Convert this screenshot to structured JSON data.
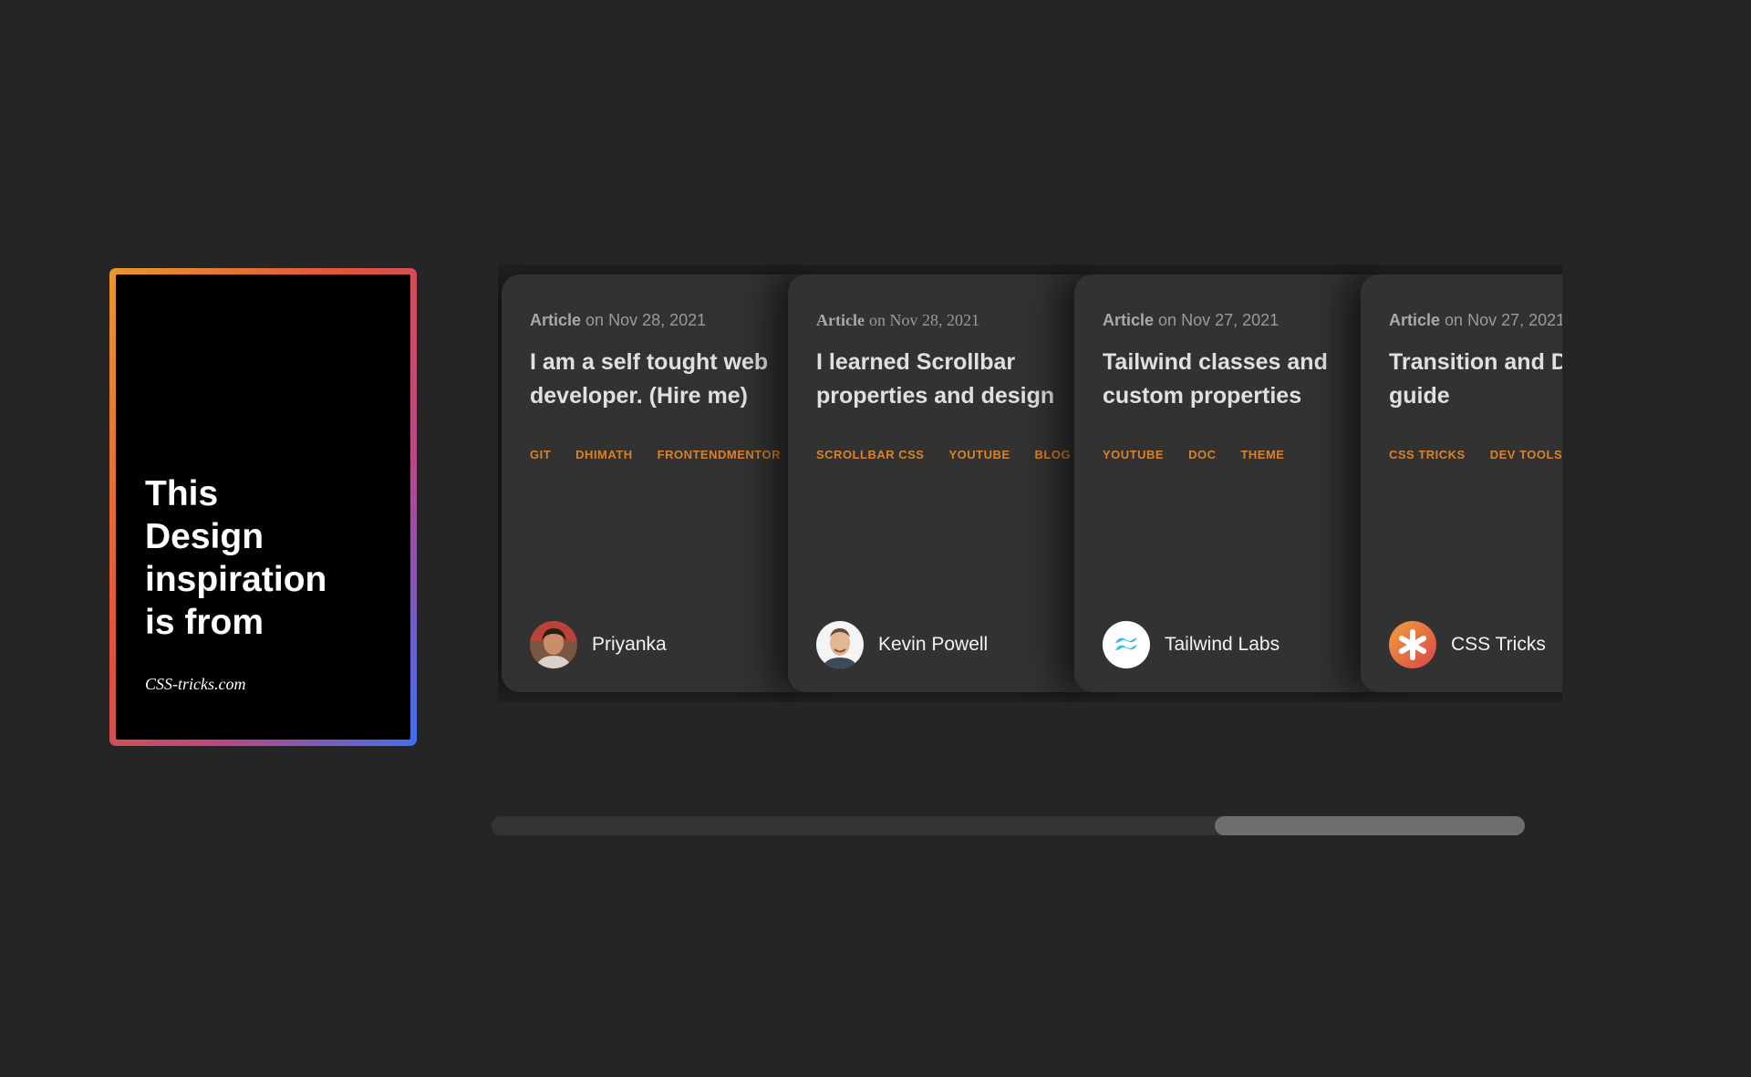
{
  "intro": {
    "title": "This\nDesign\ninspiration\nis from",
    "source": "CSS-tricks.com"
  },
  "cards": [
    {
      "type": "Article",
      "date": "on Nov 28, 2021",
      "title_lines": [
        "I am a self tought web",
        "developer. (Hire me)"
      ],
      "tags": [
        "GIT",
        "DHIMATH",
        "FRONTENDMENTOR"
      ],
      "author": "Priyanka",
      "avatar_icon": "person-photo-icon"
    },
    {
      "type": "Article",
      "date": "on Nov 28, 2021",
      "title_lines": [
        "I learned Scrollbar",
        "properties and design"
      ],
      "tags": [
        "SCROLLBAR CSS",
        "YOUTUBE",
        "BLOG"
      ],
      "author": "Kevin Powell",
      "avatar_icon": "person-photo-icon"
    },
    {
      "type": "Article",
      "date": "on Nov 27, 2021",
      "title_lines": [
        "Tailwind classes and",
        "custom properties"
      ],
      "tags": [
        "YOUTUBE",
        "DOC",
        "THEME"
      ],
      "author": "Tailwind Labs",
      "avatar_icon": "tailwind-logo-icon"
    },
    {
      "type": "Article",
      "date": "on Nov 27, 2021",
      "title_lines": [
        "Transition and DOM",
        "guide"
      ],
      "tags": [
        "CSS TRICKS",
        "DEV TOOLS"
      ],
      "author": "CSS Tricks",
      "avatar_icon": "css-tricks-logo-icon"
    }
  ],
  "scrollbar": {
    "thumb_start": 0.7,
    "thumb_end": 1.0
  },
  "colors": {
    "background": "#252525",
    "card": "#323232",
    "tag": "#d9822b",
    "gradient_start": "#e8972c",
    "gradient_end": "#3f6ff0"
  }
}
